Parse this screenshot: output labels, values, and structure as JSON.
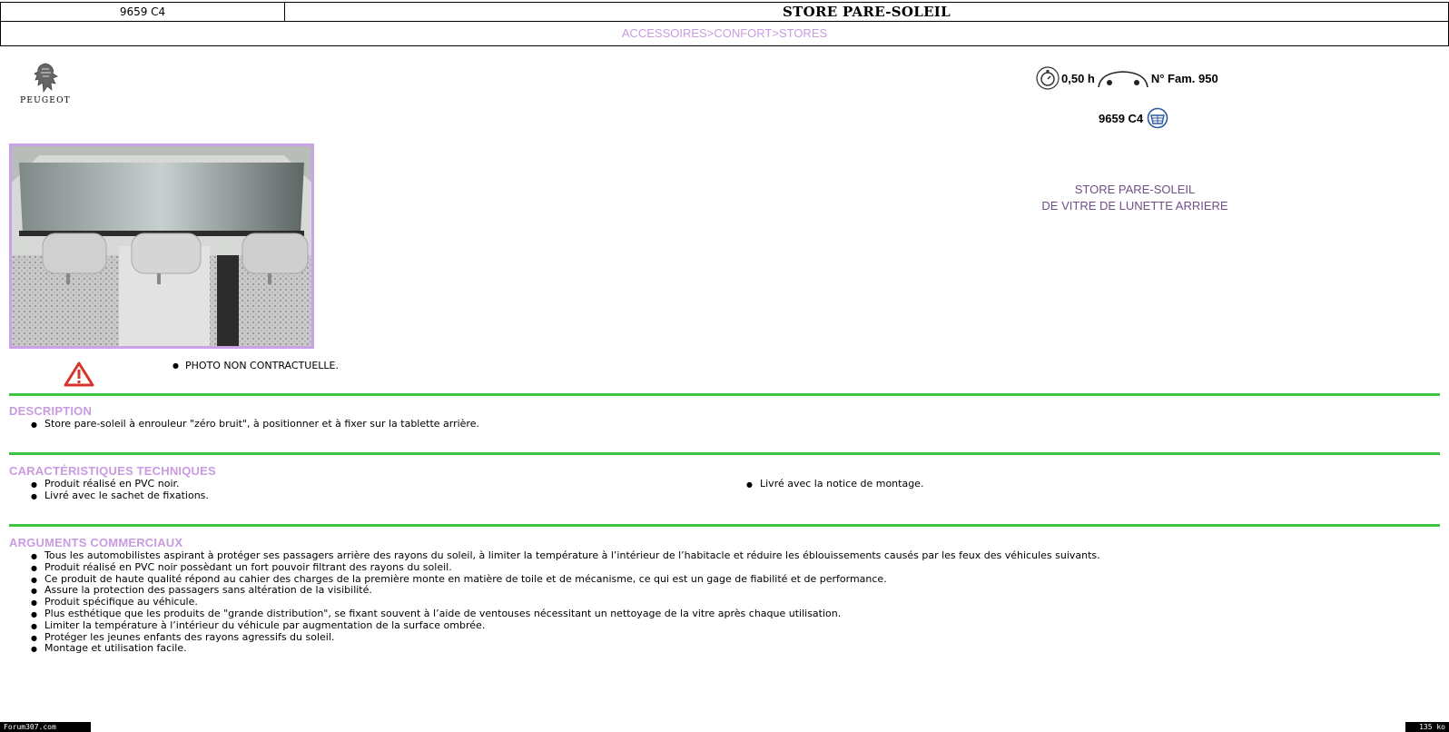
{
  "header": {
    "reference": "9659 C4",
    "title": "STORE PARE-SOLEIL",
    "breadcrumb": "ACCESSOIRES>CONFORT>STORES"
  },
  "brand": {
    "name": "PEUGEOT"
  },
  "spec": {
    "time": "0,50 h",
    "family": "N° Fam. 950",
    "reference": "9659 C4"
  },
  "product_title": {
    "line1": "STORE PARE-SOLEIL",
    "line2": "DE VITRE DE LUNETTE ARRIERE"
  },
  "photo_note": "PHOTO NON CONTRACTUELLE.",
  "sections": {
    "description": {
      "title": "DESCRIPTION",
      "items": [
        "Store pare-soleil à enrouleur \"zéro bruit\", à positionner et à fixer sur la tablette arrière."
      ]
    },
    "technical": {
      "title": "CARACTÉRISTIQUES TECHNIQUES",
      "left_items": [
        "Produit réalisé en PVC noir.",
        "Livré avec le sachet de fixations."
      ],
      "right_items": [
        "Livré avec la notice de montage."
      ]
    },
    "commercial": {
      "title": "ARGUMENTS COMMERCIAUX",
      "items": [
        "Tous les automobilistes aspirant à protéger ses passagers arrière des rayons du soleil, à limiter la température à l’intérieur de l’habitacle et réduire les éblouissements causés par les feux des véhicules suivants.",
        "Produit réalisé en PVC noir possèdant un fort pouvoir filtrant des rayons du soleil.",
        "Ce produit de haute qualité répond au cahier des charges de la première monte en matière de toile et de mécanisme, ce qui est un gage de fiabilité et de performance.",
        "Assure la protection des passagers sans altération de la visibilité.",
        "Produit spécifique au véhicule.",
        "Plus esthétique que les produits de \"grande distribution\", se fixant souvent à l’aide de ventouses nécessitant un nettoyage de la vitre après chaque utilisation.",
        "Limiter la température à l’intérieur du véhicule par augmentation de la surface ombrée.",
        "Protéger les jeunes enfants des rayons agressifs du soleil.",
        "Montage et utilisation facile."
      ]
    }
  },
  "footer": {
    "left": "Forum307.com",
    "right": "135 ko"
  },
  "colors": {
    "accent_purple": "#c99be0",
    "rule_green": "#3fc43f",
    "title_purple": "#6f4f86",
    "warning_red": "#d9342b"
  }
}
